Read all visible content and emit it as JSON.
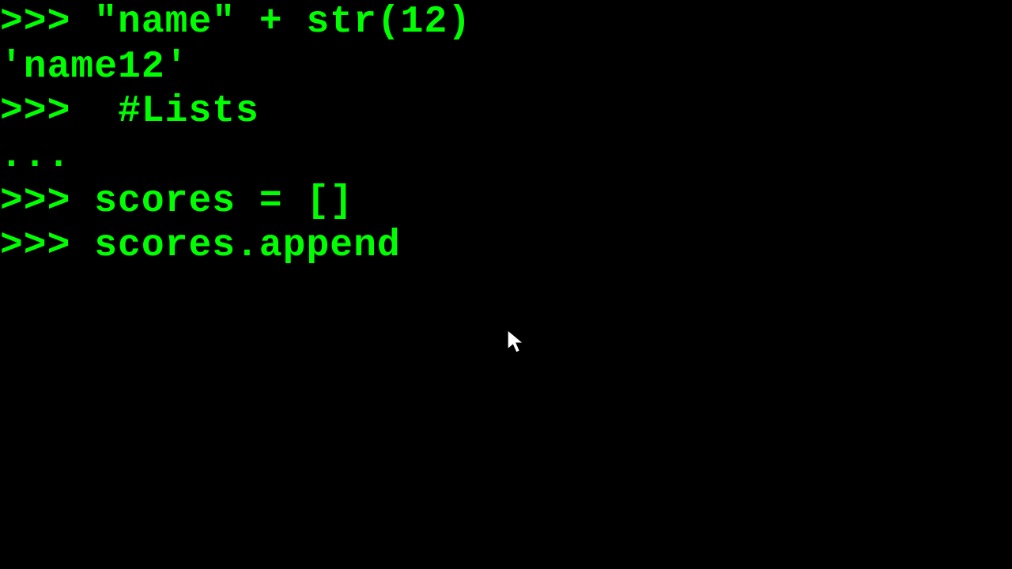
{
  "terminal": {
    "lines": [
      {
        "type": "input",
        "prompt": ">>> ",
        "text": "\"name\" + str(12)"
      },
      {
        "type": "output",
        "prompt": "",
        "text": "'name12'"
      },
      {
        "type": "input",
        "prompt": ">>> ",
        "text": " #Lists"
      },
      {
        "type": "continuation",
        "prompt": "...",
        "text": ""
      },
      {
        "type": "input",
        "prompt": ">>> ",
        "text": "scores = []"
      },
      {
        "type": "input",
        "prompt": ">>> ",
        "text": "scores.append"
      }
    ]
  },
  "colors": {
    "background": "#000000",
    "foreground": "#00ff00"
  }
}
